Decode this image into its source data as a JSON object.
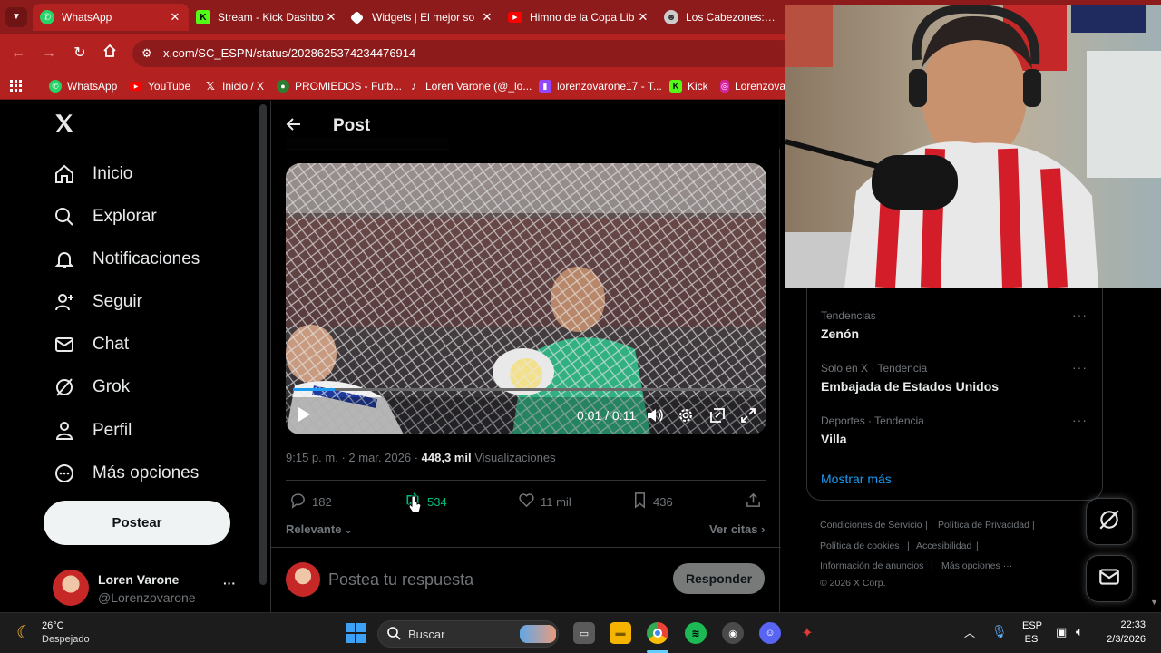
{
  "browser": {
    "tabs": [
      {
        "title": "WhatsApp",
        "favicon": "whatsapp-icon",
        "color": "#25d366"
      },
      {
        "title": "Stream - Kick Dashbo",
        "favicon": "kick-icon",
        "color": "#53fc18"
      },
      {
        "title": "Widgets | El mejor so",
        "favicon": "widgets-icon",
        "color": "#ffffff"
      },
      {
        "title": "Himno de la Copa Lib",
        "favicon": "youtube-icon",
        "color": "#ff0000"
      },
      {
        "title": "Los Cabezones: Copa",
        "favicon": "cabezones-icon",
        "color": "#cccccc"
      }
    ],
    "address": "x.com/SC_ESPN/status/2028625374234476914",
    "bookmarks": [
      {
        "label": "WhatsApp",
        "icon": "whatsapp-icon",
        "color": "#25d366"
      },
      {
        "label": "YouTube",
        "icon": "youtube-icon",
        "color": "#ff0000"
      },
      {
        "label": "Inicio / X",
        "icon": "x-logo-icon",
        "color": "#000000"
      },
      {
        "label": "PROMIEDOS - Futb...",
        "icon": "promiedos-icon",
        "color": "#2e7d32"
      },
      {
        "label": "Loren Varone (@_lo...",
        "icon": "tiktok-icon",
        "color": "#000000"
      },
      {
        "label": "lorenzovarone17 - T...",
        "icon": "twitch-icon",
        "color": "#9146ff"
      },
      {
        "label": "Kick",
        "icon": "kick-icon",
        "color": "#53fc18"
      },
      {
        "label": "Lorenzova",
        "icon": "instagram-icon",
        "color": "#d6249f"
      }
    ],
    "theme_color": "#b32121"
  },
  "sidebar": {
    "items": [
      {
        "label": "Inicio",
        "icon": "home-icon"
      },
      {
        "label": "Explorar",
        "icon": "search-icon"
      },
      {
        "label": "Notificaciones",
        "icon": "bell-icon"
      },
      {
        "label": "Seguir",
        "icon": "follow-icon"
      },
      {
        "label": "Chat",
        "icon": "mail-icon"
      },
      {
        "label": "Grok",
        "icon": "grok-icon"
      },
      {
        "label": "Perfil",
        "icon": "person-icon"
      },
      {
        "label": "Más opciones",
        "icon": "more-circle-icon"
      }
    ],
    "post_button": "Postear",
    "profile": {
      "name": "Loren Varone",
      "handle": "@Lorenzovarone",
      "more": "···"
    }
  },
  "post": {
    "header_title": "Post",
    "video": {
      "time": "0:01 / 0:11"
    },
    "meta": {
      "time": "9:15 p. m.",
      "sep1": "·",
      "date": "2 mar. 2026",
      "sep2": "·",
      "views_count": "448,3 mil",
      "views_label": "Visualizaciones"
    },
    "actions": {
      "replies": "182",
      "reposts": "534",
      "likes": "11 mil",
      "bookmarks": "436"
    },
    "sort_label": "Relevante",
    "quotes_label": "Ver citas",
    "reply_placeholder": "Postea tu respuesta",
    "reply_button": "Responder"
  },
  "trends": [
    {
      "context": "Tendencias",
      "name": "Zenón"
    },
    {
      "context": "Solo en X · Tendencia",
      "name": "Embajada de Estados Unidos"
    },
    {
      "context": "Deportes · Tendencia",
      "name": "Villa"
    }
  ],
  "show_more": "Mostrar más",
  "footer": {
    "links": [
      "Condiciones de Servicio",
      "Política de Privacidad",
      "Política de cookies",
      "Accesibilidad",
      "Información de anuncios",
      "Más opciones ···"
    ],
    "copyright": "© 2026 X Corp."
  },
  "taskbar": {
    "weather_temp": "26°C",
    "weather_desc": "Despejado",
    "search_label": "Buscar",
    "lang_top": "ESP",
    "lang_bottom": "ES",
    "time": "22:33",
    "date": "2/3/2026"
  },
  "colors": {
    "accent": "#1d9bf0",
    "repost_green": "#00ba7c",
    "text_secondary": "#71767b"
  }
}
